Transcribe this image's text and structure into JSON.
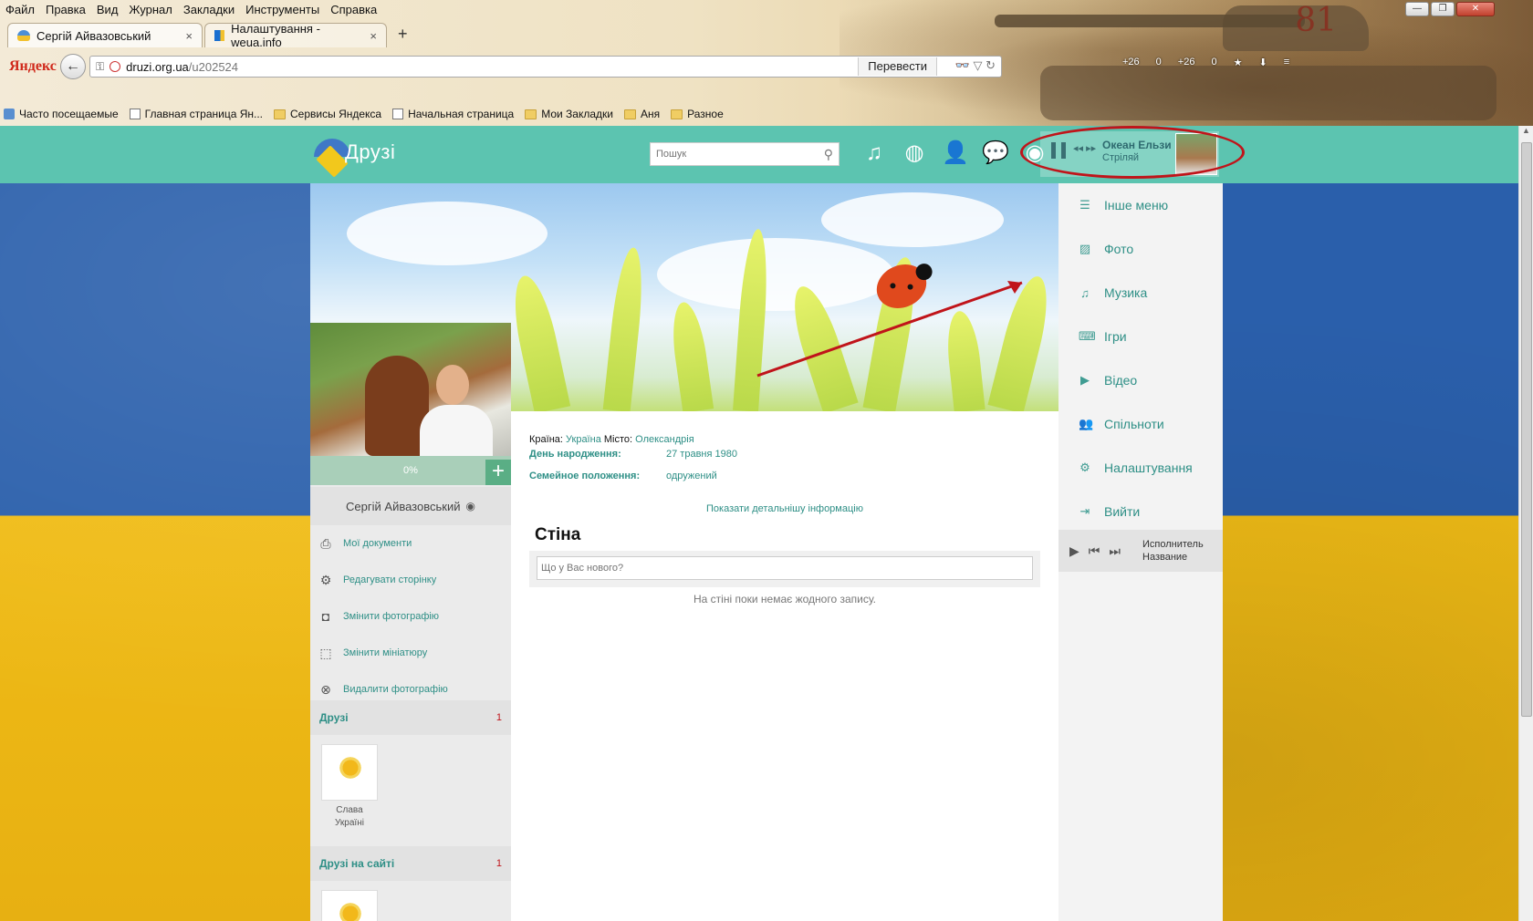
{
  "browser": {
    "menu": [
      "Файл",
      "Правка",
      "Вид",
      "Журнал",
      "Закладки",
      "Инструменты",
      "Справка"
    ],
    "tabs": [
      {
        "title": "Сергій Айвазовський",
        "active": true
      },
      {
        "title": "Налаштування - weua.info",
        "active": false
      }
    ],
    "new_tab": "+",
    "close_glyph": "×",
    "brand": "Яндекс",
    "url_host": "druzi.org.ua",
    "url_path": "/u202524",
    "translate": "Перевести",
    "tool_counts": [
      "+26",
      "0",
      "+26",
      "0"
    ],
    "bookmarks": [
      "Часто посещаемые",
      "Главная страница Ян...",
      "Сервисы Яндекса",
      "Начальная страница",
      "Мои Закладки",
      "Аня",
      "Разное"
    ],
    "tank_number": "81"
  },
  "site": {
    "logo_text": "Друзі",
    "search_placeholder": "Пошук",
    "top_icons": [
      "music-icon",
      "globe-icon",
      "user-icon",
      "chat-icon",
      "eye-icon"
    ]
  },
  "player": {
    "artist": "Океан Ельзи",
    "song": "Стріляй"
  },
  "profile": {
    "progress": "0%",
    "progress_value": 0,
    "name": "Сергій Айвазовський",
    "menu": [
      {
        "icon": "print-icon",
        "label": "Мої документи"
      },
      {
        "icon": "gear-icon",
        "label": "Редагувати сторінку"
      },
      {
        "icon": "camera-icon",
        "label": "Змінити фотографію"
      },
      {
        "icon": "crop-icon",
        "label": "Змінити мініатюру"
      },
      {
        "icon": "remove-icon",
        "label": "Видалити фотографію"
      }
    ],
    "friends_label": "Друзі",
    "friends_count": "1",
    "friend_name_line1": "Слава",
    "friend_name_line2": "Україні",
    "site_friends_label": "Друзі на сайті",
    "site_friends_count": "1"
  },
  "info": {
    "country_label": "Країна:",
    "country": "Україна",
    "city_label": "Місто:",
    "city": "Олександрія",
    "birthday_label": "День народження:",
    "birthday": "27 травня 1980",
    "status_label": "Семейное положення:",
    "status": "одружений",
    "show_more": "Показати детальнішу інформацію"
  },
  "wall": {
    "title": "Стіна",
    "placeholder": "Що у Вас нового?",
    "empty": "На стіні поки немає жодного запису."
  },
  "right_menu": [
    {
      "icon": "list-icon",
      "label": "Інше меню"
    },
    {
      "icon": "photo-icon",
      "label": "Фото"
    },
    {
      "icon": "music-icon",
      "label": "Музика"
    },
    {
      "icon": "gamepad-icon",
      "label": "Ігри"
    },
    {
      "icon": "video-icon",
      "label": "Відео"
    },
    {
      "icon": "group-icon",
      "label": "Спільноти"
    },
    {
      "icon": "gear-icon",
      "label": "Налаштування"
    },
    {
      "icon": "exit-icon",
      "label": "Вийти"
    }
  ],
  "mini_player": {
    "artist": "Исполнитель",
    "title": "Название"
  },
  "colors": {
    "header": "#5cc4b0",
    "accent": "#2e8f86",
    "annotation": "#c0141a"
  }
}
